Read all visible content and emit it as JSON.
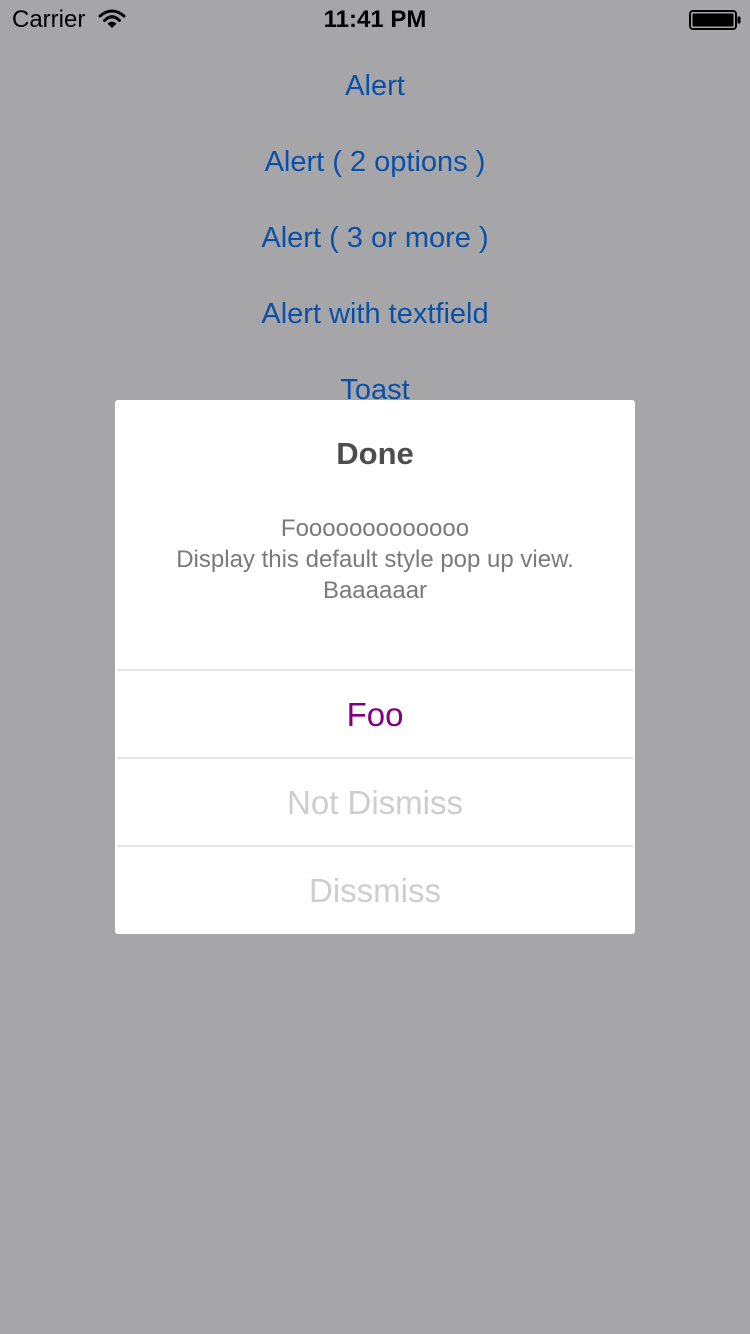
{
  "status_bar": {
    "carrier": "Carrier",
    "time": "11:41 PM",
    "wifi_icon": "wifi-icon",
    "battery_icon": "battery-icon"
  },
  "menu": {
    "items": [
      {
        "label": "Alert"
      },
      {
        "label": "Alert ( 2 options )"
      },
      {
        "label": "Alert ( 3 or more )"
      },
      {
        "label": "Alert with textfield"
      },
      {
        "label": "Toast"
      }
    ]
  },
  "dialog": {
    "title": "Done",
    "message_lines": [
      "Fooooooooooooo",
      "Display this default style pop up view.",
      "Baaaaaar"
    ],
    "buttons": [
      {
        "label": "Foo",
        "color": "#800080"
      },
      {
        "label": "Not Dismiss",
        "color": "#cdcdcd"
      },
      {
        "label": "Dissmiss",
        "color": "#cdcdcd"
      }
    ]
  },
  "colors": {
    "dim_background": "#a6a6a8",
    "link_blue": "#0b50a8",
    "dialog_background": "#ffffff"
  }
}
